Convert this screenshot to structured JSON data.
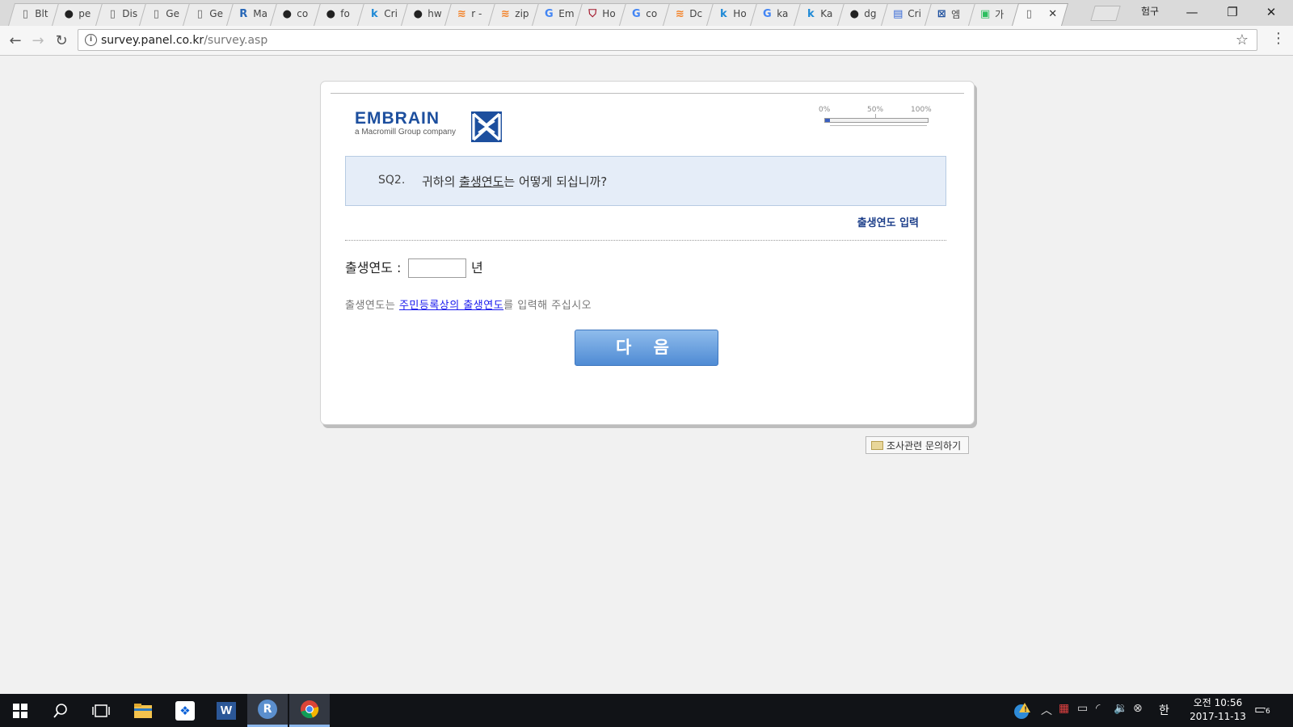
{
  "browser": {
    "tabs": [
      {
        "title": "Blt",
        "icon": "document-icon"
      },
      {
        "title": "pe",
        "icon": "github-icon"
      },
      {
        "title": "Dis",
        "icon": "document-icon"
      },
      {
        "title": "Ge",
        "icon": "document-icon"
      },
      {
        "title": "Ge",
        "icon": "document-icon"
      },
      {
        "title": "Ma",
        "icon": "r-icon"
      },
      {
        "title": "co",
        "icon": "github-icon"
      },
      {
        "title": "fo",
        "icon": "github-icon"
      },
      {
        "title": "Cri",
        "icon": "k-icon"
      },
      {
        "title": "hw",
        "icon": "github-icon"
      },
      {
        "title": "r -",
        "icon": "stack-icon"
      },
      {
        "title": "zip",
        "icon": "stack-icon"
      },
      {
        "title": "Em",
        "icon": "google-icon"
      },
      {
        "title": "Ho",
        "icon": "shield-icon"
      },
      {
        "title": "co",
        "icon": "google-icon"
      },
      {
        "title": "Dc",
        "icon": "stack-icon"
      },
      {
        "title": "Ho",
        "icon": "k-icon"
      },
      {
        "title": "ka",
        "icon": "google-icon"
      },
      {
        "title": "Ka",
        "icon": "k-icon"
      },
      {
        "title": "dg",
        "icon": "github-icon"
      },
      {
        "title": "Cri",
        "icon": "table-icon"
      },
      {
        "title": "엠",
        "icon": "embrain-icon"
      },
      {
        "title": "가",
        "icon": "green-icon"
      },
      {
        "title": "",
        "icon": "document-icon",
        "active": true
      }
    ],
    "profile_name": "험구",
    "url_host": "survey.panel.co.kr",
    "url_path": "/survey.asp"
  },
  "survey": {
    "logo_name": "EMBRAIN",
    "logo_sub": "a Macromill Group company",
    "progress_ticks": [
      "0%",
      "50%",
      "100%"
    ],
    "progress_fraction": 0.05,
    "question_number": "SQ2.",
    "question_before": "귀하의 ",
    "question_underlined": "출생연도",
    "question_after": "는 어떻게 되십니까?",
    "instruction_label": "출생연도 입력",
    "field_label": "출생연도 :",
    "year_value": "",
    "unit": "년",
    "hint_before": "출생연도는 ",
    "hint_link": "주민등록상의 출생연도",
    "hint_after": "를 입력해 주십시오",
    "next_button": "다 음",
    "inquiry_button": "조사관련 문의하기"
  },
  "taskbar": {
    "clock_time": "오전 10:56",
    "clock_date": "2017-11-13",
    "ime": "한",
    "notification_count": "6"
  },
  "colors": {
    "accent": "#1d4f9e",
    "question_bg": "#e5edf8",
    "button": "#5b95dc"
  }
}
